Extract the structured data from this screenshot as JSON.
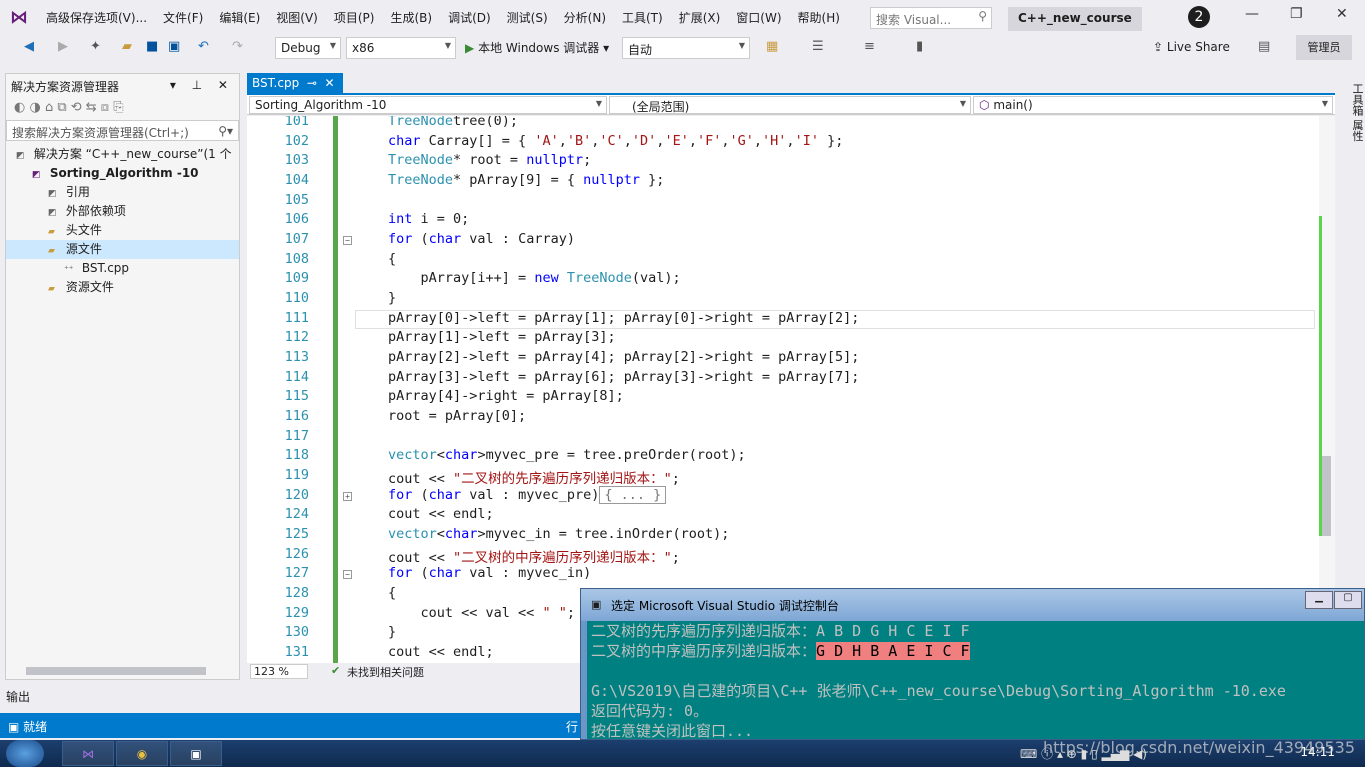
{
  "menubar": {
    "items": [
      "高级保存选项(V)...",
      "文件(F)",
      "编辑(E)",
      "视图(V)",
      "项目(P)",
      "生成(B)",
      "调试(D)",
      "测试(S)",
      "分析(N)",
      "工具(T)",
      "扩展(X)",
      "窗口(W)",
      "帮助(H)"
    ],
    "search_placeholder": "搜索 Visual...",
    "project": "C++_new_course",
    "notifications": "2"
  },
  "toolbar": {
    "config": "Debug",
    "platform": "x86",
    "run": "本地 Windows 调试器",
    "auto": "自动",
    "live_share": "Live Share",
    "admin": "管理员"
  },
  "solution": {
    "title": "解决方案资源管理器",
    "search": "搜索解决方案资源管理器(Ctrl+;)",
    "tree": [
      {
        "label": "解决方案 “C++_new_course”(1 个",
        "indent": 0,
        "icon": "solution-icon"
      },
      {
        "label": "Sorting_Algorithm -10",
        "indent": 1,
        "icon": "project-icon",
        "bold": true
      },
      {
        "label": "引用",
        "indent": 2,
        "icon": "references-icon"
      },
      {
        "label": "外部依赖项",
        "indent": 2,
        "icon": "dependencies-icon"
      },
      {
        "label": "头文件",
        "indent": 2,
        "icon": "folder-icon"
      },
      {
        "label": "源文件",
        "indent": 2,
        "icon": "folder-icon",
        "selected": true
      },
      {
        "label": "BST.cpp",
        "indent": 3,
        "icon": "cpp-file-icon"
      },
      {
        "label": "资源文件",
        "indent": 2,
        "icon": "folder-icon"
      }
    ]
  },
  "editor": {
    "tab": "BST.cpp",
    "nav_project": "Sorting_Algorithm -10",
    "nav_scope": "(全局范围)",
    "nav_member": "main()",
    "zoom": "123 %",
    "issues": "未找到相关问题",
    "lines": [
      {
        "n": "101",
        "t": [
          [
            "ty",
            "TreeNode"
          ],
          [
            "",
            "tree(0);"
          ]
        ]
      },
      {
        "n": "102",
        "t": [
          [
            "kw",
            "char"
          ],
          [
            "",
            " Carray[] = { "
          ],
          [
            "st",
            "'A'"
          ],
          [
            "",
            ","
          ],
          [
            "st",
            "'B'"
          ],
          [
            "",
            ","
          ],
          [
            "st",
            "'C'"
          ],
          [
            "",
            ","
          ],
          [
            "st",
            "'D'"
          ],
          [
            "",
            ","
          ],
          [
            "st",
            "'E'"
          ],
          [
            "",
            ","
          ],
          [
            "st",
            "'F'"
          ],
          [
            "",
            ","
          ],
          [
            "st",
            "'G'"
          ],
          [
            "",
            ","
          ],
          [
            "st",
            "'H'"
          ],
          [
            "",
            ","
          ],
          [
            "st",
            "'I'"
          ],
          [
            "",
            " };"
          ]
        ]
      },
      {
        "n": "103",
        "t": [
          [
            "ty",
            "TreeNode"
          ],
          [
            "",
            "* root = "
          ],
          [
            "kw",
            "nullptr"
          ],
          [
            "",
            ";"
          ]
        ]
      },
      {
        "n": "104",
        "t": [
          [
            "ty",
            "TreeNode"
          ],
          [
            "",
            "* pArray[9] = { "
          ],
          [
            "kw",
            "nullptr"
          ],
          [
            "",
            " };"
          ]
        ]
      },
      {
        "n": "105",
        "t": []
      },
      {
        "n": "106",
        "t": [
          [
            "kw",
            "int"
          ],
          [
            "",
            " i = 0;"
          ]
        ]
      },
      {
        "n": "107",
        "t": [
          [
            "kw",
            "for"
          ],
          [
            "",
            " ("
          ],
          [
            "kw",
            "char"
          ],
          [
            "",
            " val : Carray)"
          ]
        ],
        "fold": "-"
      },
      {
        "n": "108",
        "t": [
          [
            "",
            "{"
          ]
        ]
      },
      {
        "n": "109",
        "t": [
          [
            "",
            "    pArray[i++] = "
          ],
          [
            "kw",
            "new"
          ],
          [
            " ",
            ""
          ],
          [
            "ty",
            " TreeNode"
          ],
          [
            "",
            "(val);"
          ]
        ]
      },
      {
        "n": "110",
        "t": [
          [
            "",
            "}"
          ]
        ]
      },
      {
        "n": "111",
        "t": [
          [
            "",
            "pArray[0]->left = pArray[1]; pArray[0]->right = pArray[2];"
          ]
        ],
        "current": true
      },
      {
        "n": "112",
        "t": [
          [
            "",
            "pArray[1]->left = pArray[3];"
          ]
        ]
      },
      {
        "n": "113",
        "t": [
          [
            "",
            "pArray[2]->left = pArray[4]; pArray[2]->right = pArray[5];"
          ]
        ]
      },
      {
        "n": "114",
        "t": [
          [
            "",
            "pArray[3]->left = pArray[6]; pArray[3]->right = pArray[7];"
          ]
        ]
      },
      {
        "n": "115",
        "t": [
          [
            "",
            "pArray[4]->right = pArray[8];"
          ]
        ]
      },
      {
        "n": "116",
        "t": [
          [
            "",
            "root = pArray[0];"
          ]
        ]
      },
      {
        "n": "117",
        "t": []
      },
      {
        "n": "118",
        "t": [
          [
            "ty",
            "vector"
          ],
          [
            "",
            "<"
          ],
          [
            "kw",
            "char"
          ],
          [
            "",
            ">myvec_pre = tree.preOrder(root);"
          ]
        ]
      },
      {
        "n": "119",
        "t": [
          [
            "",
            "cout << "
          ],
          [
            "st",
            "\"二叉树的先序遍历序列递归版本：\""
          ],
          [
            "",
            ";"
          ]
        ]
      },
      {
        "n": "120",
        "t": [
          [
            "kw",
            "for"
          ],
          [
            "",
            " ("
          ],
          [
            "kw",
            "char"
          ],
          [
            "",
            " val : myvec_pre)"
          ],
          [
            "col",
            "{ ... }"
          ]
        ],
        "fold": "+"
      },
      {
        "n": "124",
        "t": [
          [
            "",
            "cout << endl;"
          ]
        ]
      },
      {
        "n": "125",
        "t": [
          [
            "ty",
            "vector"
          ],
          [
            "",
            "<"
          ],
          [
            "kw",
            "char"
          ],
          [
            "",
            ">myvec_in = tree.inOrder(root);"
          ]
        ]
      },
      {
        "n": "126",
        "t": [
          [
            "",
            "cout << "
          ],
          [
            "st",
            "\"二叉树的中序遍历序列递归版本：\""
          ],
          [
            "",
            ";"
          ]
        ]
      },
      {
        "n": "127",
        "t": [
          [
            "kw",
            "for"
          ],
          [
            "",
            " ("
          ],
          [
            "kw",
            "char"
          ],
          [
            "",
            " val : myvec_in)"
          ]
        ],
        "fold": "-"
      },
      {
        "n": "128",
        "t": [
          [
            "",
            "{"
          ]
        ]
      },
      {
        "n": "129",
        "t": [
          [
            "",
            "    cout << val << "
          ],
          [
            "st",
            "\" \""
          ],
          [
            "",
            ";"
          ]
        ]
      },
      {
        "n": "130",
        "t": [
          [
            "",
            "}"
          ]
        ]
      },
      {
        "n": "131",
        "t": [
          [
            "",
            "cout << endl;"
          ]
        ]
      }
    ]
  },
  "right_tabs": "工具箱  属性",
  "output_label": "输出",
  "status": "就绪",
  "status_right": "行",
  "console": {
    "title": "选定 Microsoft Visual Studio 调试控制台",
    "line1_prefix": "二叉树的先序遍历序列递归版本：",
    "line1_value": "A B D G H C E I F",
    "line2_prefix": "二叉树的中序遍历序列递归版本：",
    "line2_value": "G D H B A E I C F",
    "path": "G:\\VS2019\\自己建的项目\\C++ 张老师\\C++_new_course\\Debug\\Sorting_Algorithm -10.exe",
    "exit": "返回代码为: 0。",
    "press": "按任意键关闭此窗口..."
  },
  "taskbar": {
    "clock": "14:11",
    "watermark": "https://blog.csdn.net/weixin_43949535"
  }
}
